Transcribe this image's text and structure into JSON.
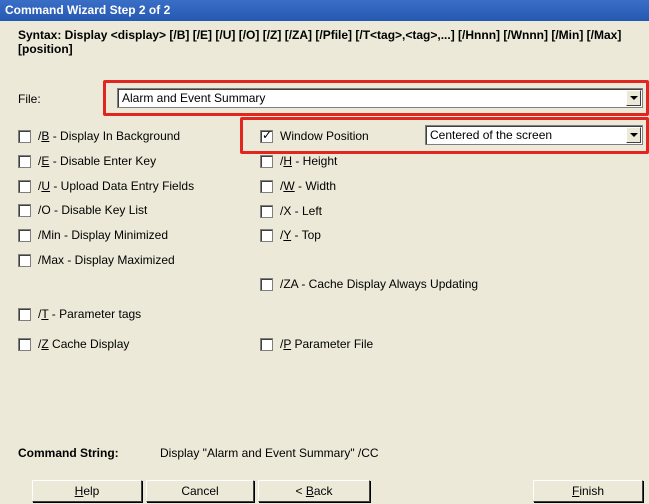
{
  "window": {
    "title": "Command Wizard Step 2 of 2"
  },
  "syntax": {
    "text": "Syntax: Display <display> [/B] [/E] [/U] [/O] [/Z] [/ZA] [/Pfile] [/T<tag>,<tag>,...] [/Hnnn] [/Wnnn] [/Min] [/Max] [position]"
  },
  "file": {
    "label": "File:",
    "value": "Alarm and Event Summary"
  },
  "position": {
    "label": "Window Position",
    "checked": true,
    "value": "Centered of the screen"
  },
  "options_left": [
    {
      "key": "B",
      "pre": "/",
      "rest": " - Display In Background",
      "checked": false
    },
    {
      "key": "E",
      "pre": "/",
      "rest": " - Disable Enter Key",
      "checked": false
    },
    {
      "key": "U",
      "pre": "/",
      "rest": " - Upload Data Entry Fields",
      "checked": false
    },
    {
      "key": "",
      "pre": "/O - Disable Key List",
      "rest": "",
      "checked": false
    },
    {
      "key": "",
      "pre": "/Min - Display Minimized",
      "rest": "",
      "checked": false
    },
    {
      "key": "",
      "pre": "/Max - Display Maximized",
      "rest": "",
      "checked": false
    },
    {
      "key": "T",
      "pre": "/",
      "rest": " - Parameter tags",
      "checked": false
    },
    {
      "key": "Z",
      "pre": "/",
      "rest": "  Cache Display",
      "checked": false
    }
  ],
  "options_right": [
    {
      "key": "H",
      "pre": "/",
      "rest": " - Height",
      "checked": false
    },
    {
      "key": "W",
      "pre": "/",
      "rest": " - Width",
      "checked": false
    },
    {
      "key": "",
      "pre": "/X - Left",
      "rest": "",
      "checked": false
    },
    {
      "key": "Y",
      "pre": "/",
      "rest": " - Top",
      "checked": false
    },
    {
      "key": "",
      "pre": "/ZA - Cache Display Always Updating",
      "rest": "",
      "checked": false
    },
    {
      "key": "P",
      "pre": "/",
      "rest": "  Parameter File",
      "checked": false
    }
  ],
  "command": {
    "label": "Command String:",
    "value": "Display \"Alarm and Event Summary\" /CC"
  },
  "buttons": {
    "help": {
      "key": "H",
      "rest": "elp"
    },
    "cancel": {
      "label": "Cancel"
    },
    "back": {
      "pre": "< ",
      "key": "B",
      "rest": "ack"
    },
    "finish": {
      "key": "F",
      "rest": "inish"
    }
  },
  "colors": {
    "title_bar": "#2658b1",
    "highlight": "#e0261f",
    "dialog_bg": "#ece9d8"
  }
}
